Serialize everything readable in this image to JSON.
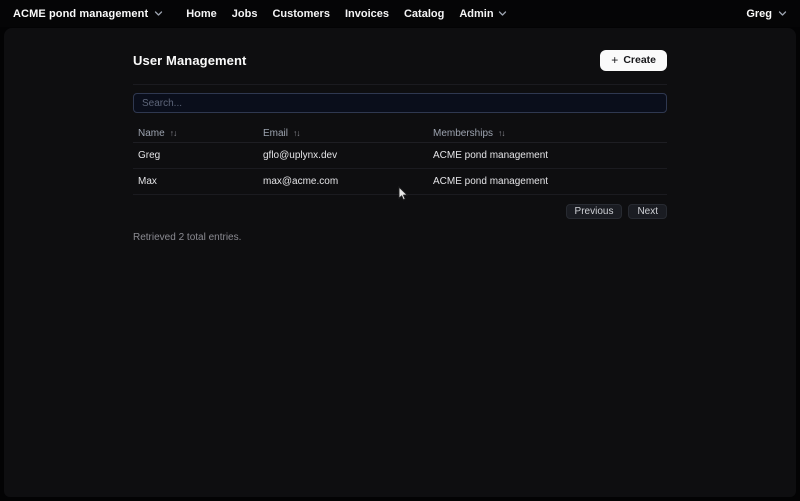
{
  "topbar": {
    "brand": "ACME pond management",
    "nav": [
      "Home",
      "Jobs",
      "Customers",
      "Invoices",
      "Catalog",
      "Admin"
    ],
    "user": "Greg"
  },
  "page": {
    "title": "User Management",
    "create_label": "Create",
    "search_placeholder": "Search...",
    "summary": "Retrieved 2 total entries."
  },
  "table": {
    "columns": [
      "Name",
      "Email",
      "Memberships"
    ],
    "rows": [
      {
        "name": "Greg",
        "email": "gflo@uplynx.dev",
        "memberships": "ACME pond management"
      },
      {
        "name": "Max",
        "email": "max@acme.com",
        "memberships": "ACME pond management"
      }
    ]
  },
  "pagination": {
    "previous": "Previous",
    "next": "Next"
  },
  "icons": {
    "sort": "↑↓",
    "plus": "+"
  },
  "colors": {
    "accent": "#fafafa",
    "panel": "#0e0e10",
    "input_border": "#2f3850"
  }
}
